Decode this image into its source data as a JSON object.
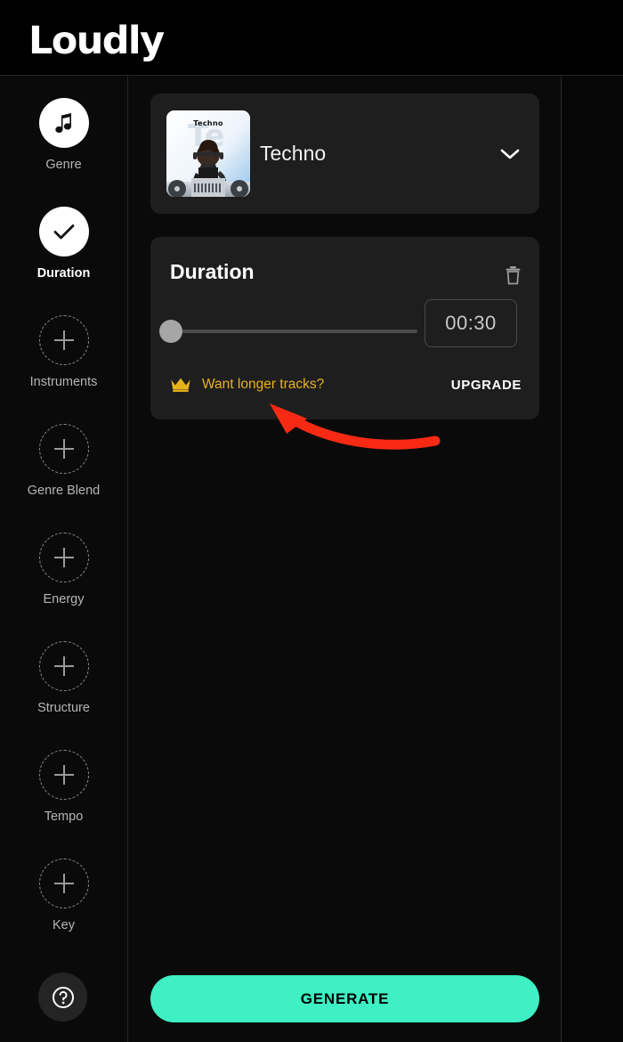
{
  "header": {
    "logo": "Loudly"
  },
  "sidebar": {
    "items": [
      {
        "label": "Genre",
        "icon": "music-note-icon",
        "state": "selected",
        "style": "filled"
      },
      {
        "label": "Duration",
        "icon": "check-icon",
        "state": "active",
        "style": "filled"
      },
      {
        "label": "Instruments",
        "icon": "plus-icon",
        "state": "empty",
        "style": "dashed"
      },
      {
        "label": "Genre Blend",
        "icon": "plus-icon",
        "state": "empty",
        "style": "dashed"
      },
      {
        "label": "Energy",
        "icon": "plus-icon",
        "state": "empty",
        "style": "dashed"
      },
      {
        "label": "Structure",
        "icon": "plus-icon",
        "state": "empty",
        "style": "dashed"
      },
      {
        "label": "Tempo",
        "icon": "plus-icon",
        "state": "empty",
        "style": "dashed"
      },
      {
        "label": "Key",
        "icon": "plus-icon",
        "state": "empty",
        "style": "dashed"
      }
    ],
    "help": {
      "icon": "help-circle-icon",
      "label": "?"
    }
  },
  "main": {
    "genre_card": {
      "name": "Techno",
      "thumbnail_caption": "Techno",
      "thumbnail_watermark": "Te",
      "expand_icon": "chevron-down-icon"
    },
    "duration_card": {
      "title": "Duration",
      "delete_icon": "trash-icon",
      "slider": {
        "value": 30,
        "min": 15,
        "max": 300,
        "percent": 0
      },
      "time_value": "00:30",
      "promo": {
        "icon": "crown-icon",
        "text": "Want longer tracks?",
        "cta": "UPGRADE"
      }
    },
    "generate_label": "GENERATE"
  },
  "annotation": {
    "arrow": {
      "color": "#f82a14",
      "points_to": "Want longer tracks?"
    }
  },
  "colors": {
    "accent_green": "#3ef0c4",
    "promo_gold": "#e7b31c",
    "card_bg": "#1e1e1e",
    "page_bg": "#0a0a0a",
    "annotation_red": "#f82a14"
  }
}
